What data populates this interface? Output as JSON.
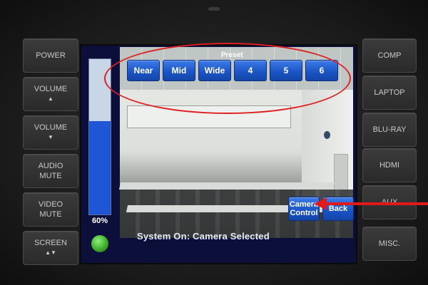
{
  "left_buttons": [
    {
      "label": "POWER",
      "icon": ""
    },
    {
      "label": "VOLUME",
      "icon": "▲"
    },
    {
      "label": "VOLUME",
      "icon": "▼"
    },
    {
      "label": "AUDIO\nMUTE",
      "line1": "AUDIO",
      "line2": "MUTE",
      "icon": ""
    },
    {
      "label": "VIDEO\nMUTE",
      "line1": "VIDEO",
      "line2": "MUTE",
      "icon": ""
    },
    {
      "label": "SCREEN",
      "icon": "▲▼"
    }
  ],
  "right_buttons": [
    "COMP",
    "LAPTOP",
    "BLU-RAY",
    "HDMI",
    "AUX",
    "MISC."
  ],
  "preset": {
    "label": "Preset",
    "buttons": [
      "Near",
      "Mid",
      "Wide",
      "4",
      "5",
      "6"
    ]
  },
  "volume": {
    "percent_label": "60%",
    "level": 0.6
  },
  "camera_control": {
    "line1": "Camera",
    "line2": "Control"
  },
  "back_label": "Back",
  "status": "System On:  Camera Selected",
  "colors": {
    "button_blue": "#1a53c4",
    "volume_fill": "#1f56d6",
    "status_led": "#3fae2b",
    "annotation_red": "#e01a1a"
  }
}
